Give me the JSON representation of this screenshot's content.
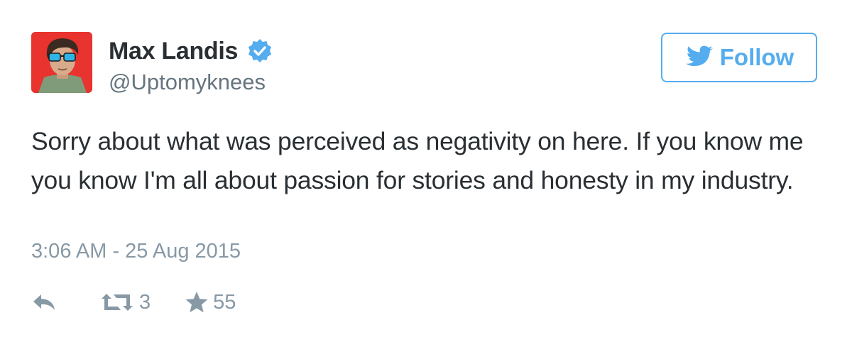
{
  "user": {
    "display_name": "Max Landis",
    "handle": "@Uptomyknees",
    "verified": true
  },
  "follow_button": {
    "label": "Follow",
    "icon": "twitter-bird-icon"
  },
  "tweet": {
    "text": "Sorry about what was perceived as negativity on here. If you know me you know I'm all about passion for stories and honesty in my industry.",
    "timestamp": "3:06 AM - 25 Aug 2015"
  },
  "actions": {
    "reply": {
      "icon": "reply-icon"
    },
    "retweet": {
      "icon": "retweet-icon",
      "count": "3"
    },
    "favorite": {
      "icon": "star-icon",
      "count": "55"
    }
  },
  "colors": {
    "accent": "#55acee",
    "text": "#292f33",
    "secondary": "#8899a6",
    "handle": "#66757f",
    "avatar_bg": "#e8332f"
  }
}
